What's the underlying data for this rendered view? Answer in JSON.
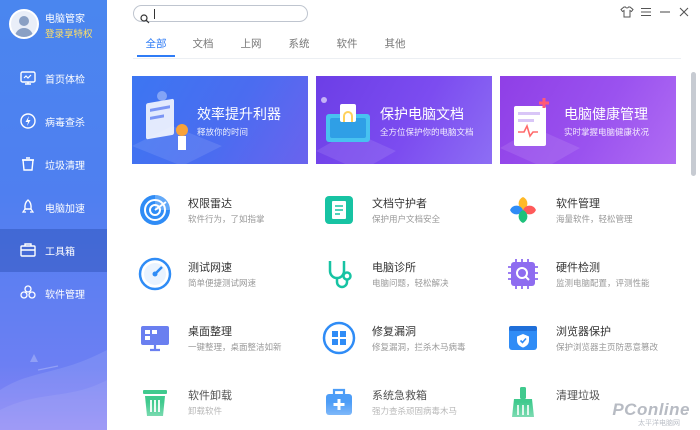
{
  "sidebar": {
    "app_title": "电脑管家",
    "login_link": "登录享特权",
    "items": [
      {
        "label": "首页体检",
        "icon": "monitor-icon"
      },
      {
        "label": "病毒查杀",
        "icon": "lightning-shield-icon"
      },
      {
        "label": "垃圾清理",
        "icon": "trash-icon"
      },
      {
        "label": "电脑加速",
        "icon": "rocket-icon"
      },
      {
        "label": "工具箱",
        "icon": "toolbox-icon",
        "active": true
      },
      {
        "label": "软件管理",
        "icon": "software-icon"
      }
    ]
  },
  "search": {
    "value": "",
    "placeholder": ""
  },
  "window_controls": [
    "skin-icon",
    "menu-icon",
    "minimize-icon",
    "close-icon"
  ],
  "tabs": [
    {
      "label": "全部",
      "active": true
    },
    {
      "label": "文档"
    },
    {
      "label": "上网"
    },
    {
      "label": "系统"
    },
    {
      "label": "软件"
    },
    {
      "label": "其他"
    }
  ],
  "banners": [
    {
      "title": "效率提升利器",
      "subtitle": "释放你的时间"
    },
    {
      "title": "保护电脑文档",
      "subtitle": "全方位保护你的电脑文档"
    },
    {
      "title": "电脑健康管理",
      "subtitle": "实时掌握电脑健康状况"
    }
  ],
  "tools": [
    {
      "title": "权限雷达",
      "subtitle": "软件行为，了如指掌",
      "icon": "radar-icon"
    },
    {
      "title": "文档守护者",
      "subtitle": "保护用户文档安全",
      "icon": "document-guard-icon"
    },
    {
      "title": "软件管理",
      "subtitle": "海量软件，轻松管理",
      "icon": "software-manager-icon"
    },
    {
      "title": "测试网速",
      "subtitle": "简单便捷测试网速",
      "icon": "speedometer-icon"
    },
    {
      "title": "电脑诊所",
      "subtitle": "电脑问题，轻松解决",
      "icon": "stethoscope-icon"
    },
    {
      "title": "硬件检测",
      "subtitle": "监测电脑配置，评测性能",
      "icon": "chip-icon"
    },
    {
      "title": "桌面整理",
      "subtitle": "一键整理，桌面整洁如新",
      "icon": "desktop-icon"
    },
    {
      "title": "修复漏洞",
      "subtitle": "修复漏洞，拦杀木马病毒",
      "icon": "windows-patch-icon"
    },
    {
      "title": "浏览器保护",
      "subtitle": "保护浏览器主页防恶意篡改",
      "icon": "browser-shield-icon"
    },
    {
      "title": "软件卸载",
      "subtitle": "卸载软件",
      "icon": "uninstall-trash-icon"
    },
    {
      "title": "系统急救箱",
      "subtitle": "强力查杀顽固病毒木马",
      "icon": "first-aid-icon"
    },
    {
      "title": "清理垃圾",
      "subtitle": "",
      "icon": "broom-icon"
    }
  ],
  "watermark": {
    "text": "PConline",
    "sub": "太平洋电脑网"
  },
  "colors": {
    "accent": "#2f7cf6",
    "sidebar": "#4f7ff0"
  }
}
